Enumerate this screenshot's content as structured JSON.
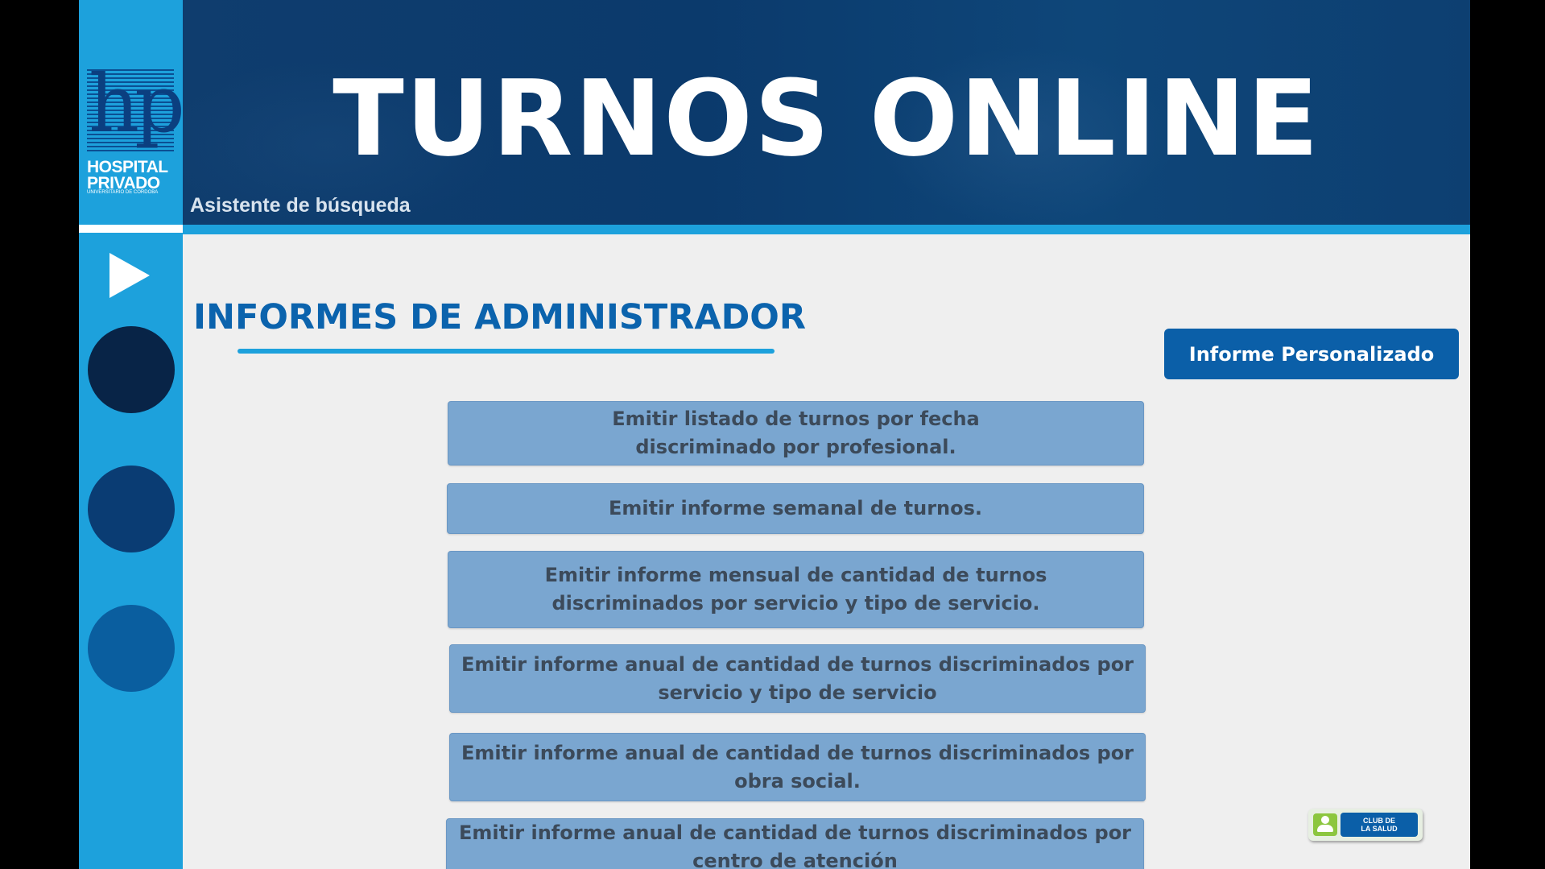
{
  "app": {
    "title": "TURNOS ONLINE",
    "subtitle": "Asistente de búsqueda"
  },
  "logo": {
    "mark": "hp",
    "name": "HOSPITAL\nPRIVADO",
    "sub": "UNIVERSITARIO DE CORDOBA"
  },
  "sidebar": {
    "play_icon": "play-icon",
    "nav_circles": [
      {
        "name": "nav-circle-1",
        "color": "#082447"
      },
      {
        "name": "nav-circle-2",
        "color": "#0a3c73"
      },
      {
        "name": "nav-circle-3",
        "color": "#0a5e9f"
      }
    ]
  },
  "main": {
    "section_title": "INFORMES DE ADMINISTRADOR",
    "custom_report_label": "Informe Personalizado",
    "reports": [
      "Emitir listado de turnos por fecha\ndiscriminado por profesional.",
      "Emitir informe semanal de turnos.",
      "Emitir informe mensual de cantidad de turnos\ndiscriminados por servicio y tipo de servicio.",
      "Emitir informe anual de cantidad de turnos discriminados por\nservicio y tipo de servicio",
      "Emitir informe anual de cantidad de turnos discriminados por\nobra social.",
      "Emitir informe anual de cantidad de turnos discriminados por\ncentro de atención"
    ]
  },
  "badge": {
    "label": "CLUB DE\nLA SALUD"
  },
  "colors": {
    "accent": "#1da1dc",
    "primary": "#0b5fa8",
    "header": "#0f3d6e",
    "report_button": "#7aa6d0"
  }
}
